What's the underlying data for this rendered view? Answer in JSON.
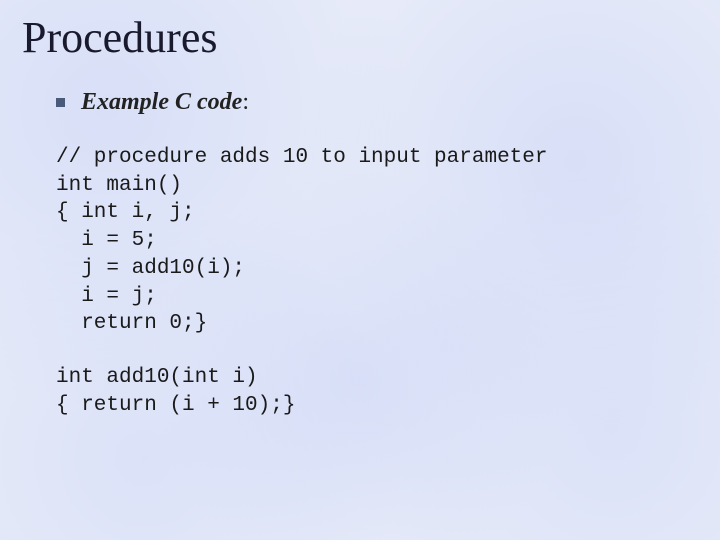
{
  "title": "Procedures",
  "bullet": {
    "label": "Example C code",
    "suffix": ":"
  },
  "code": {
    "block1": "// procedure adds 10 to input parameter\nint main()\n{ int i, j;\n  i = 5;\n  j = add10(i);\n  i = j;\n  return 0;}",
    "block2": "int add10(int i)\n{ return (i + 10);}"
  }
}
